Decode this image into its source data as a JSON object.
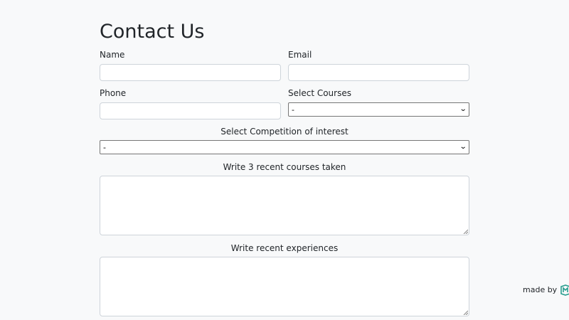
{
  "page": {
    "title": "Contact Us"
  },
  "form": {
    "name_label": "Name",
    "email_label": "Email",
    "phone_label": "Phone",
    "courses_label": "Select Courses",
    "courses_value": "-",
    "competition_label": "Select Competition of interest",
    "competition_value": "-",
    "recent_courses_label": "Write 3 recent courses taken",
    "experiences_label": "Write recent experiences"
  },
  "footer": {
    "made_by": "made by",
    "logo_icon": "m-logo-icon",
    "logo_color": "#2a9d8f"
  }
}
